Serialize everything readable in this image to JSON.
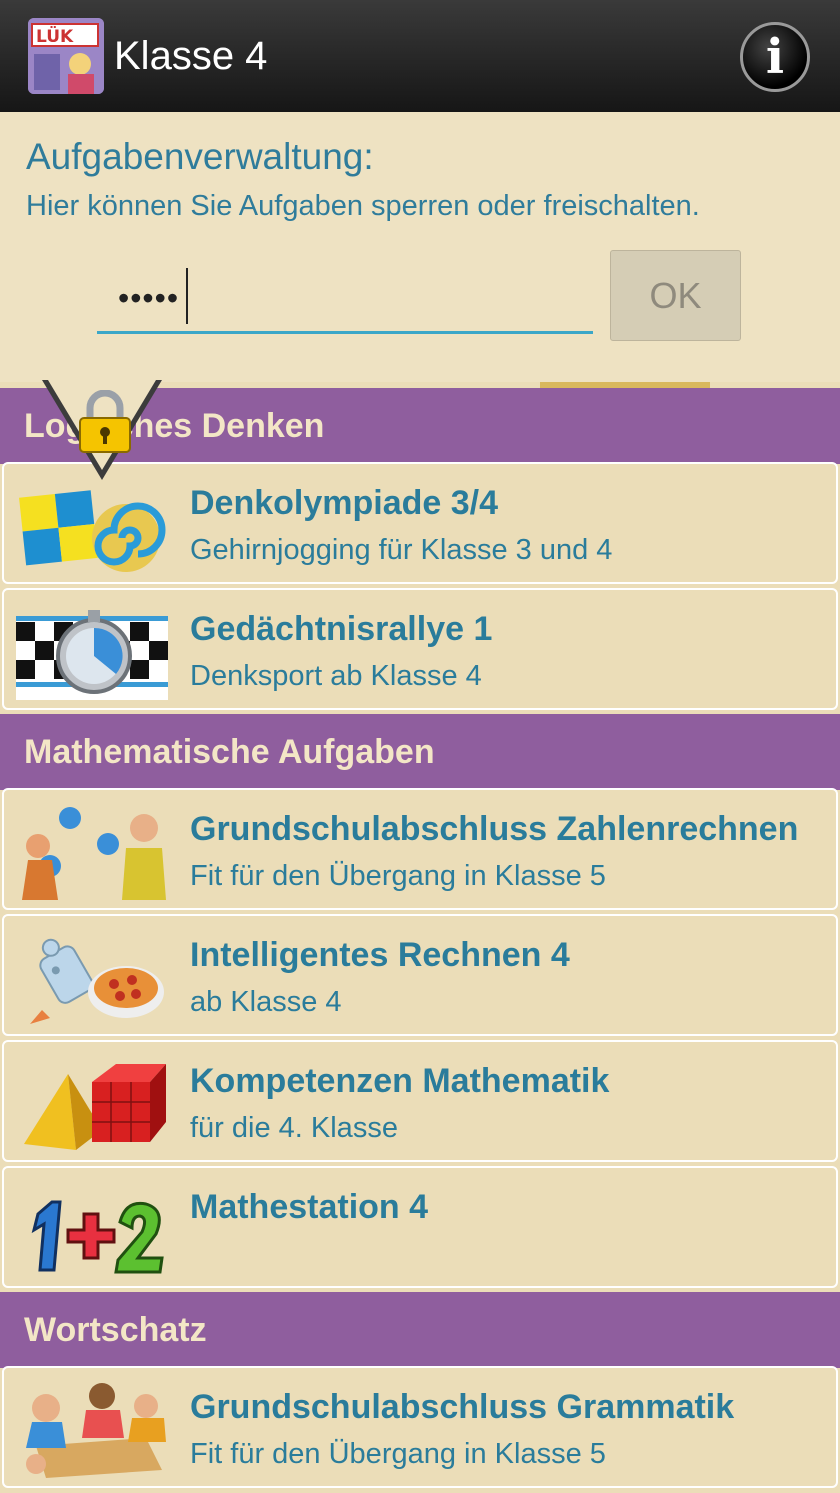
{
  "appbar": {
    "title": "Klasse 4",
    "info_label": "i"
  },
  "panel": {
    "title": "Aufgabenverwaltung:",
    "subtitle": "Hier können Sie Aufgaben sperren oder freischalten.",
    "password_value": "•••••",
    "ok_label": "OK"
  },
  "sections": [
    {
      "header": "Logisches Denken",
      "items": [
        {
          "title": "Denkolympiade 3/4",
          "subtitle": "Gehirnjogging für Klasse 3 und 4",
          "icon": "puzzle-icon"
        },
        {
          "title": "Gedächtnisrallye 1",
          "subtitle": "Denksport ab Klasse 4",
          "icon": "stopwatch-icon"
        }
      ]
    },
    {
      "header": "Mathematische Aufgaben",
      "items": [
        {
          "title": "Grundschulabschluss Zahlenrechnen",
          "subtitle": "Fit für den Übergang in Klasse 5",
          "icon": "kids-balls-icon"
        },
        {
          "title": "Intelligentes Rechnen 4",
          "subtitle": "ab Klasse 4",
          "icon": "robot-pizza-icon"
        },
        {
          "title": "Kompetenzen Mathematik",
          "subtitle": "für die 4. Klasse",
          "icon": "geometry-cubes-icon"
        },
        {
          "title": "Mathestation 4",
          "subtitle": "",
          "icon": "one-plus-two-icon"
        }
      ]
    },
    {
      "header": "Wortschatz",
      "items": [
        {
          "title": "Grundschulabschluss Grammatik",
          "subtitle": "Fit für den Übergang in Klasse 5",
          "icon": "kids-table-icon"
        }
      ]
    }
  ],
  "colors": {
    "section_bg": "#8F5E9E",
    "card_bg": "#EBDDB8",
    "text_blue": "#2A7C9B",
    "accent": "#3BA7C8"
  }
}
